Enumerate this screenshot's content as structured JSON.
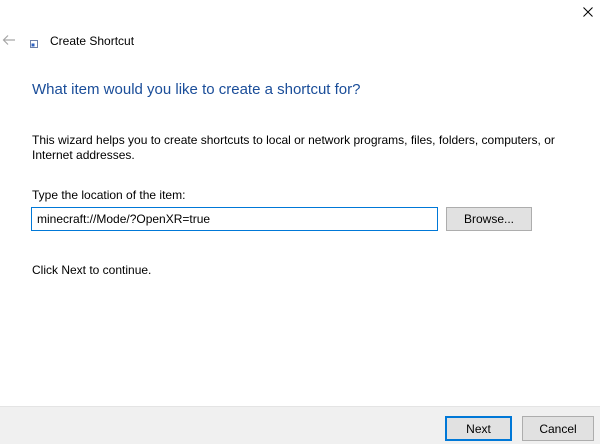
{
  "window": {
    "title": "Create Shortcut",
    "back_icon": "arrow-left-icon",
    "close_icon": "close-icon",
    "title_icon": "shortcut-icon"
  },
  "wizard": {
    "heading": "What item would you like to create a shortcut for?",
    "description": "This wizard helps you to create shortcuts to local or network programs, files, folders, computers, or Internet addresses.",
    "location_label": "Type the location of the item:",
    "location_value": "minecraft://Mode/?OpenXR=true",
    "browse_label": "Browse...",
    "continue_text": "Click Next to continue."
  },
  "footer": {
    "next_label": "Next",
    "cancel_label": "Cancel"
  },
  "colors": {
    "accent": "#0078d7",
    "heading": "#1a4d99",
    "button_face": "#e1e1e1",
    "footer_bg": "#f0f0f0"
  }
}
